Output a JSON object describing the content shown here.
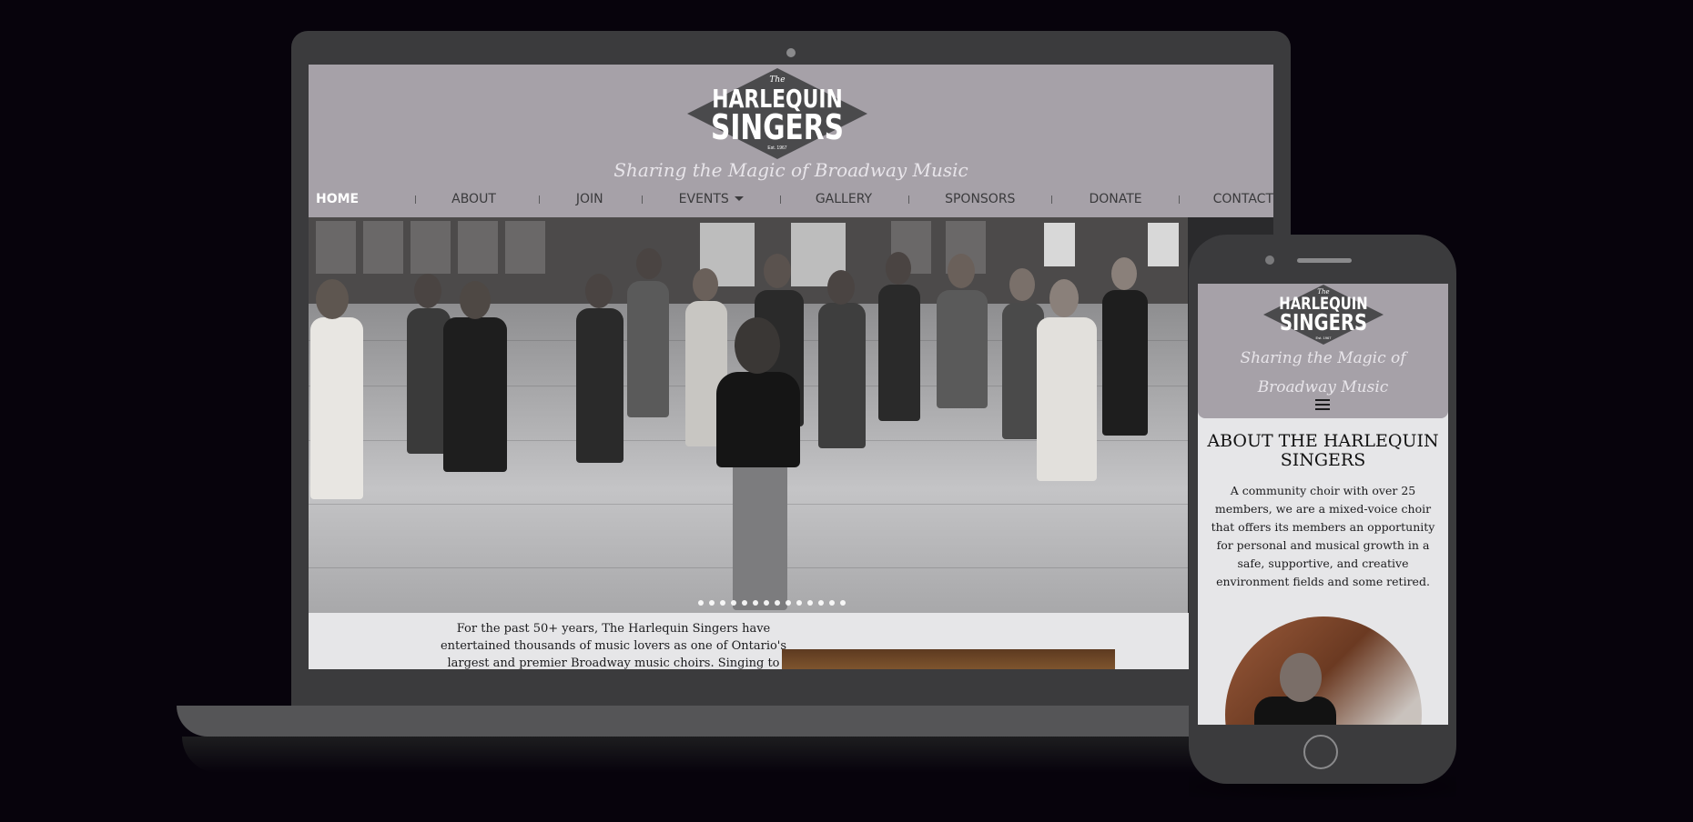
{
  "site": {
    "logo": {
      "the": "The",
      "line1": "HARLEQUIN",
      "line2": "SINGERS",
      "est": "Est. 1967"
    },
    "tagline": "Sharing the Magic of Broadway Music"
  },
  "nav": [
    {
      "label": "HOME",
      "active": true
    },
    {
      "label": "ABOUT"
    },
    {
      "label": "JOIN"
    },
    {
      "label": "EVENTS",
      "dropdown": true
    },
    {
      "label": "GALLERY"
    },
    {
      "label": "SPONSORS"
    },
    {
      "label": "DONATE"
    },
    {
      "label": "CONTACT"
    }
  ],
  "hero": {
    "slide_count": 14
  },
  "desktop_content": {
    "intro_text": "For the past 50+ years, The Harlequin Singers have entertained thousands of music lovers as one of Ontario's largest and premier Broadway music choirs. Singing to"
  },
  "mobile": {
    "tagline": "Sharing the Magic of Broadway Music",
    "about_title": "ABOUT THE HARLEQUIN SINGERS",
    "about_text": "A community choir with over 25 members, we are a mixed-voice choir that offers its members an opportunity for personal and musical growth in a safe, supportive, and creative environment fields and some retired."
  },
  "colors": {
    "header_bg": "#a6a1a8",
    "logo_dark": "#4a4a4c",
    "page_bg": "#07030c",
    "device": "#3b3b3d"
  }
}
